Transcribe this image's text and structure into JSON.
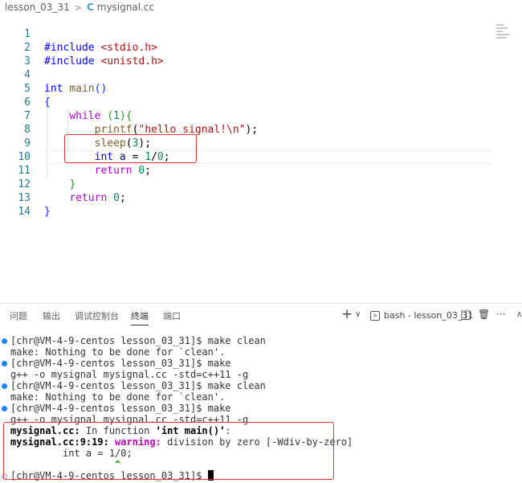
{
  "breadcrumb": {
    "folder": "lesson_03_31",
    "separator": ">",
    "file_icon": "C",
    "file": "mysignal.cc"
  },
  "editor": {
    "lines": [
      {
        "n": "1"
      },
      {
        "n": "2"
      },
      {
        "n": "3"
      },
      {
        "n": "4"
      },
      {
        "n": "5"
      },
      {
        "n": "6"
      },
      {
        "n": "7"
      },
      {
        "n": "8"
      },
      {
        "n": "9"
      },
      {
        "n": "10"
      },
      {
        "n": "11"
      },
      {
        "n": "12"
      },
      {
        "n": "13"
      },
      {
        "n": "14"
      }
    ],
    "tokens": {
      "l1_inc": "#include ",
      "l1_hdr": "<stdio.h>",
      "l2_inc": "#include ",
      "l2_hdr": "<unistd.h>",
      "l4_int": "int",
      "l4_main": " main",
      "l4_paren": "()",
      "l5_brace": "{",
      "l6_while": "while",
      "l6_cond_open": " (",
      "l6_one": "1",
      "l6_cond_close": "){",
      "l7_printf": "printf",
      "l7_open": "(",
      "l7_str": "\"hello signal!\\n\"",
      "l7_close": ");",
      "l8_sleep": "sleep",
      "l8_open": "(",
      "l8_num": "3",
      "l8_close": ");",
      "l9_int": "int",
      "l9_var": " a",
      "l9_eq": " = ",
      "l9_one": "1",
      "l9_div": "/",
      "l9_zero": "0",
      "l9_semi": ";",
      "l10_return": "return",
      "l10_zero": " 0",
      "l10_semi": ";",
      "l11_brace": "}",
      "l12_return": "return",
      "l12_zero": " 0",
      "l12_semi": ";",
      "l13_brace": "}"
    }
  },
  "panel": {
    "tabs": [
      "问题",
      "输出",
      "调试控制台",
      "终端",
      "端口"
    ],
    "active_tab": "终端",
    "actions": {
      "add": "+",
      "dropdown": "∨",
      "terminal_name": "bash - lesson_03_31",
      "split": "◫",
      "trash": "🗑",
      "more": "···",
      "collapse": "∧"
    }
  },
  "terminal": {
    "lines": [
      "[chr@VM-4-9-centos lesson_03_31]$ make clean",
      "make: Nothing to be done for `clean'.",
      "[chr@VM-4-9-centos lesson_03_31]$ make",
      "g++ -o mysignal mysignal.cc -std=c++11 -g",
      "[chr@VM-4-9-centos lesson_03_31]$ make clean",
      "make: Nothing to be done for `clean'.",
      "[chr@VM-4-9-centos lesson_03_31]$ make",
      "g++ -o mysignal mysignal.cc -std=c++11 -g"
    ],
    "diag1_file": "mysignal.cc:",
    "diag1_text": " In function ",
    "diag1_func": "‘int main()’",
    "diag1_colon": ":",
    "diag2_loc": "mysignal.cc:9:19:",
    "diag2_warn": " warning:",
    "diag2_msg": " division by zero [-Wdiv-by-zero]",
    "diag3_code": "         int a = 1/0;",
    "diag4_caret": "                  ^",
    "prompt": "[chr@VM-4-9-centos lesson_03_31]$ "
  }
}
